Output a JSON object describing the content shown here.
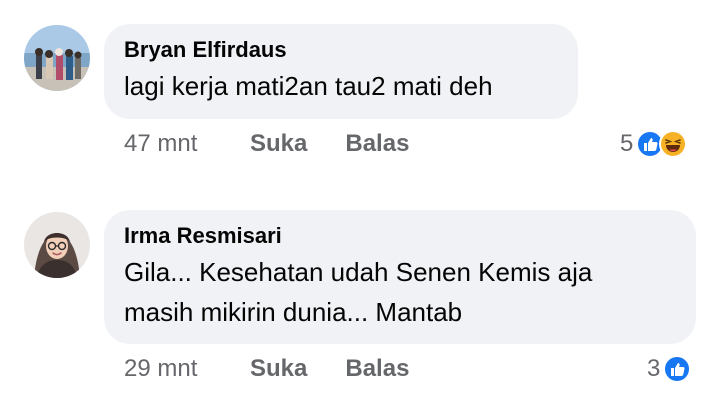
{
  "comments": [
    {
      "author": "Bryan Elfirdaus",
      "text": "lagi kerja mati2an tau2 mati deh",
      "time": "47 mnt",
      "like_label": "Suka",
      "reply_label": "Balas",
      "reaction_count": "5",
      "reactions": [
        "like-icon",
        "haha-icon"
      ]
    },
    {
      "author": "Irma Resmisari",
      "text_lines": [
        "Gila... Kesehatan udah Senen Kemis aja",
        "masih mikirin dunia... Mantab"
      ],
      "time": "29 mnt",
      "like_label": "Suka",
      "reply_label": "Balas",
      "reaction_count": "3",
      "reactions": [
        "like-icon"
      ]
    }
  ],
  "colors": {
    "bubble": "#f0f2f5",
    "meta_text": "#65676b",
    "like_blue": "#1877f2",
    "haha_yellow": "#f7b125"
  }
}
